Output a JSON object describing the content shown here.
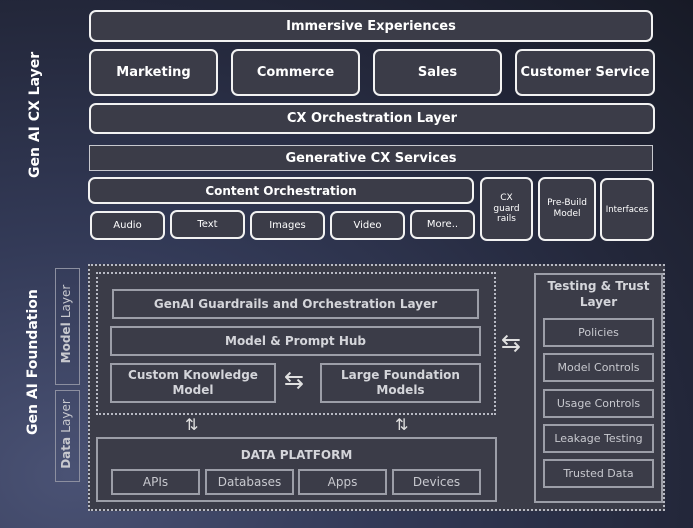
{
  "cx_layer": {
    "side_label": "Gen AI CX Layer",
    "immersive": "Immersive Experiences",
    "channels": [
      "Marketing",
      "Commerce",
      "Sales",
      "Customer Service"
    ],
    "orchestration": "CX Orchestration Layer",
    "generative_services": "Generative CX Services",
    "content_orchestration": "Content Orchestration",
    "content_types": [
      "Audio",
      "Text",
      "Images",
      "Video",
      "More.."
    ],
    "side_boxes": [
      "CX guard rails",
      "Pre-Build Model",
      "Interfaces"
    ]
  },
  "foundation": {
    "side_label": "Gen AI Foundation",
    "model_layer_label": {
      "bold": "Model",
      "rest": "Layer"
    },
    "data_layer_label": {
      "bold": "Data",
      "rest": "Layer"
    },
    "guardrails": "GenAI Guardrails and Orchestration Layer",
    "prompt_hub": "Model & Prompt Hub",
    "custom_model": "Custom Knowledge Model",
    "large_models": "Large Foundation Models",
    "data_platform": {
      "title": "DATA PLATFORM",
      "items": [
        "APIs",
        "Databases",
        "Apps",
        "Devices"
      ]
    },
    "trust": {
      "title": "Testing & Trust Layer",
      "items": [
        "Policies",
        "Model Controls",
        "Usage Controls",
        "Leakage Testing",
        "Trusted Data"
      ]
    },
    "arrows": {
      "bidirectional": "⇆",
      "vertical": "⇅"
    }
  }
}
